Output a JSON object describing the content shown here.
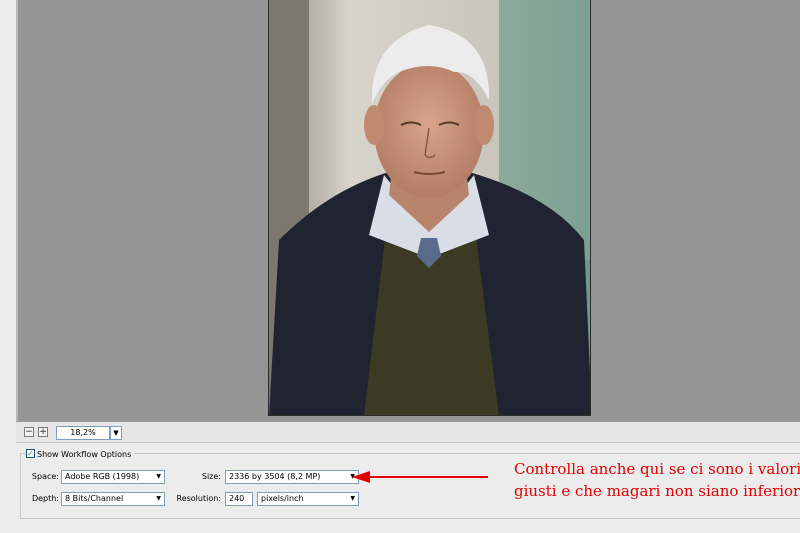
{
  "zoom": {
    "minus_label": "−",
    "plus_label": "+",
    "value": "18,2%"
  },
  "workflow": {
    "show_label": "Show Workflow Options",
    "space_label": "Space:",
    "space_value": "Adobe RGB (1998)",
    "depth_label": "Depth:",
    "depth_value": "8 Bits/Channel",
    "size_label": "Size:",
    "size_value": "2336 by 3504  (8,2 MP)",
    "resolution_label": "Resolution:",
    "resolution_value": "240",
    "resolution_unit": "pixels/inch"
  },
  "annotation": {
    "line1": "Controlla anche qui se ci sono i valori",
    "line2": "giusti e che magari non siano inferiori",
    "color": "#e00000"
  }
}
